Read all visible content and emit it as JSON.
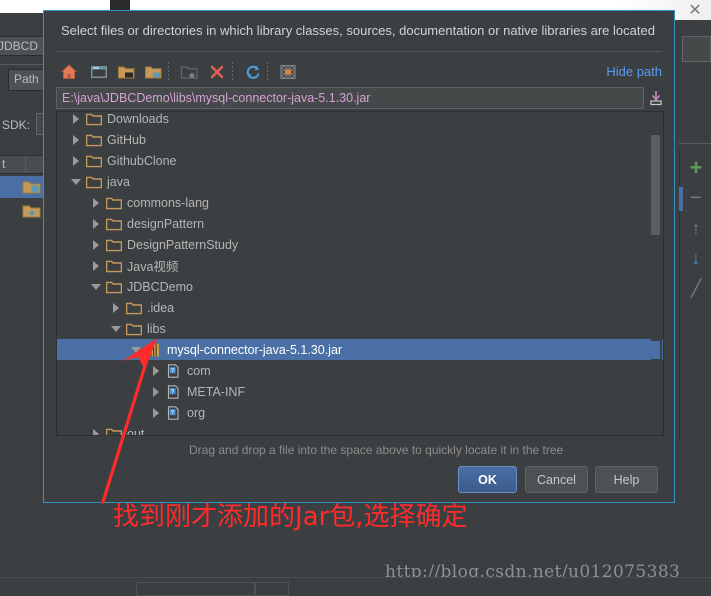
{
  "window": {
    "close_icon": "close-icon",
    "titlebar_icon": "app-icon"
  },
  "background_ide": {
    "tab_label": "JDBCD",
    "path_tab_label": "Path",
    "sdk_label": "SDK:",
    "name_col_label": "t",
    "right_toolbar": [
      {
        "name": "add-button",
        "glyph": "+",
        "color": "#5a9e5a"
      },
      {
        "name": "remove-button",
        "glyph": "−",
        "color": "#7a7d7f"
      },
      {
        "name": "move-up-button",
        "glyph": "↑",
        "color": "#7a7d7f"
      },
      {
        "name": "move-down-button",
        "glyph": "↓",
        "color": "#3f8fd0"
      },
      {
        "name": "edit-button",
        "glyph": "╱",
        "color": "#7a7d7f"
      }
    ]
  },
  "dialog": {
    "title": "Select files or directories in which library classes, sources, documentation or native libraries are located",
    "toolbar": {
      "buttons": [
        {
          "name": "home-icon",
          "title": "Home"
        },
        {
          "name": "desktop-icon",
          "title": "Desktop"
        },
        {
          "name": "project-folder-icon",
          "title": "Project"
        },
        {
          "name": "module-folder-icon",
          "title": "Module"
        },
        {
          "name": "new-folder-icon",
          "title": "New Folder"
        },
        {
          "name": "delete-icon",
          "title": "Delete"
        },
        {
          "name": "refresh-icon",
          "title": "Refresh"
        },
        {
          "name": "show-hidden-icon",
          "title": "Show Hidden Files"
        }
      ],
      "hide_path_label": "Hide path"
    },
    "path_field": {
      "value": "E:\\java\\JDBCDemo\\libs\\mysql-connector-java-5.1.30.jar",
      "placeholder": "Path",
      "drop_icon": "drop-target-icon"
    },
    "tree": [
      {
        "label": "Downloads",
        "indent": 0,
        "state": "closed",
        "icon": "folder-icon",
        "selected": false
      },
      {
        "label": "GitHub",
        "indent": 0,
        "state": "closed",
        "icon": "folder-icon",
        "selected": false
      },
      {
        "label": "GithubClone",
        "indent": 0,
        "state": "closed",
        "icon": "folder-icon",
        "selected": false
      },
      {
        "label": "java",
        "indent": 0,
        "state": "open",
        "icon": "folder-icon",
        "selected": false
      },
      {
        "label": "commons-lang",
        "indent": 1,
        "state": "closed",
        "icon": "folder-icon",
        "selected": false
      },
      {
        "label": "designPattern",
        "indent": 1,
        "state": "closed",
        "icon": "folder-icon",
        "selected": false
      },
      {
        "label": "DesignPatternStudy",
        "indent": 1,
        "state": "closed",
        "icon": "folder-icon",
        "selected": false
      },
      {
        "label": "Java视频",
        "indent": 1,
        "state": "closed",
        "icon": "folder-icon",
        "selected": false
      },
      {
        "label": "JDBCDemo",
        "indent": 1,
        "state": "open",
        "icon": "folder-icon",
        "selected": false
      },
      {
        "label": ".idea",
        "indent": 2,
        "state": "closed",
        "icon": "folder-icon",
        "selected": false
      },
      {
        "label": "libs",
        "indent": 2,
        "state": "open",
        "icon": "folder-icon",
        "selected": false
      },
      {
        "label": "mysql-connector-java-5.1.30.jar",
        "indent": 3,
        "state": "open",
        "icon": "jar-icon",
        "selected": true
      },
      {
        "label": "com",
        "indent": 4,
        "state": "closed",
        "icon": "package-icon",
        "selected": false
      },
      {
        "label": "META-INF",
        "indent": 4,
        "state": "closed",
        "icon": "package-icon",
        "selected": false
      },
      {
        "label": "org",
        "indent": 4,
        "state": "closed",
        "icon": "package-icon",
        "selected": false
      },
      {
        "label": "out",
        "indent": 1,
        "state": "closed",
        "icon": "folder-icon",
        "selected": false
      }
    ],
    "hint": "Drag and drop a file into the space above to quickly locate it in the tree",
    "buttons": {
      "ok": "OK",
      "cancel": "Cancel",
      "help": "Help"
    }
  },
  "annotation": {
    "text": "找到刚才添加的Jar包,选择确定",
    "color": "#ff2a2a",
    "arrow_name": "red-arrow-annotation"
  },
  "watermark": "http://blog.csdn.net/u012075383",
  "colors": {
    "dialog_border": "#3592c4",
    "selection": "#4a6fa5",
    "background": "#3c3f41",
    "link": "#589df6",
    "path_text": "#d4a0d4",
    "annotation_red": "#ff2a2a"
  }
}
